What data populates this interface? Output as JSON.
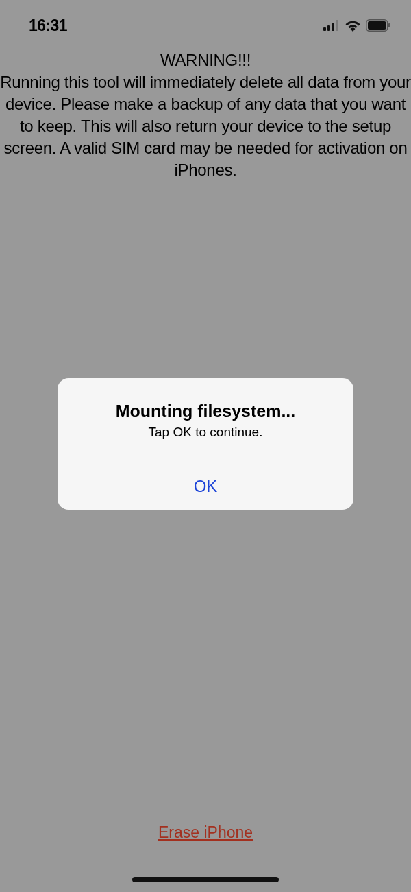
{
  "status_bar": {
    "time": "16:31"
  },
  "warning": {
    "title": "WARNING!!!",
    "body": "Running this tool will immediately delete all data from your device. Please make a backup of any data that you want to keep. This will also return your device to the setup screen.  A valid SIM card may be needed for activation on iPhones."
  },
  "alert": {
    "title": "Mounting filesystem...",
    "message": "Tap OK to continue.",
    "buttons": [
      "OK"
    ]
  },
  "erase_link": "Erase iPhone"
}
